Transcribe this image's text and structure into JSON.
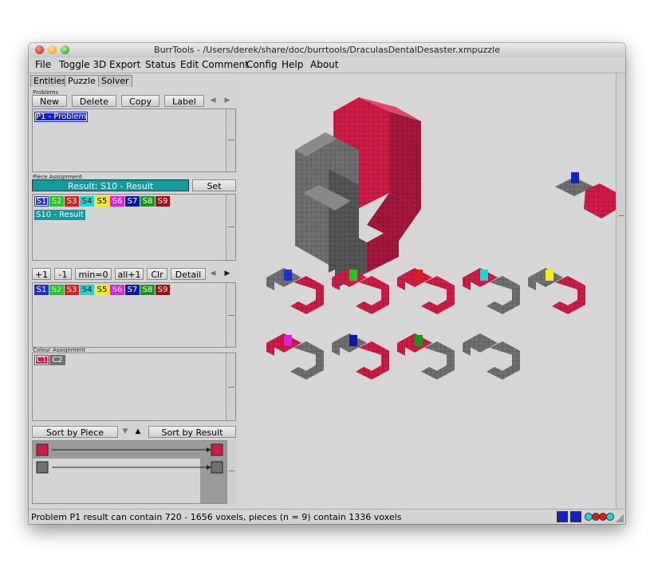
{
  "window": {
    "title": "BurrTools - /Users/derek/share/doc/burrtools/DraculasDentalDesaster.xmpuzzle"
  },
  "menu": [
    "File",
    "Toggle 3D",
    "Export",
    "Status",
    "Edit Comment",
    "Config",
    "Help",
    "About"
  ],
  "tabs": [
    "Entities",
    "Puzzle",
    "Solver"
  ],
  "problems": {
    "group_label": "Problems",
    "buttons": {
      "new": "New",
      "delete": "Delete",
      "copy": "Copy",
      "label": "Label"
    },
    "items": [
      "P1 - Problem"
    ]
  },
  "piece_assignment": {
    "group_label": "Piece Assignment",
    "result_bar": "Result: S10 - Result",
    "set_result": "Set Result",
    "result_item": "S10 - Result"
  },
  "shapes": [
    {
      "label": "S1",
      "color": "#1f2fd6"
    },
    {
      "label": "S2",
      "color": "#1ec81e"
    },
    {
      "label": "S3",
      "color": "#e11b1b"
    },
    {
      "label": "S4",
      "color": "#19d6d6"
    },
    {
      "label": "S5",
      "color": "#f2ee13"
    },
    {
      "label": "S6",
      "color": "#e01ee0"
    },
    {
      "label": "S7",
      "color": "#0a18a8"
    },
    {
      "label": "S8",
      "color": "#149b14"
    },
    {
      "label": "S9",
      "color": "#a80d0d"
    }
  ],
  "result_color": "#139a9a",
  "count_buttons": {
    "plus1": "+1",
    "minus1": "-1",
    "min0": "min=0",
    "allplus1": "all+1",
    "clr": "Clr",
    "detail": "Detail"
  },
  "colour_assignment": {
    "group_label": "Colour Assignment",
    "colors": [
      {
        "label": "C1",
        "color": "#d11a44"
      },
      {
        "label": "C2",
        "color": "#6f6f6f"
      }
    ]
  },
  "sort": {
    "by_piece": "Sort by Piece",
    "by_result": "Sort by Result"
  },
  "status": "Problem P1 result can contain 720 - 1656 voxels, pieces (n = 9) contain 1336 voxels",
  "palette": {
    "red": "#d11a44",
    "gray": "#6f6f6f",
    "result_bg": "#139a9a",
    "selection": "#1420c8"
  }
}
